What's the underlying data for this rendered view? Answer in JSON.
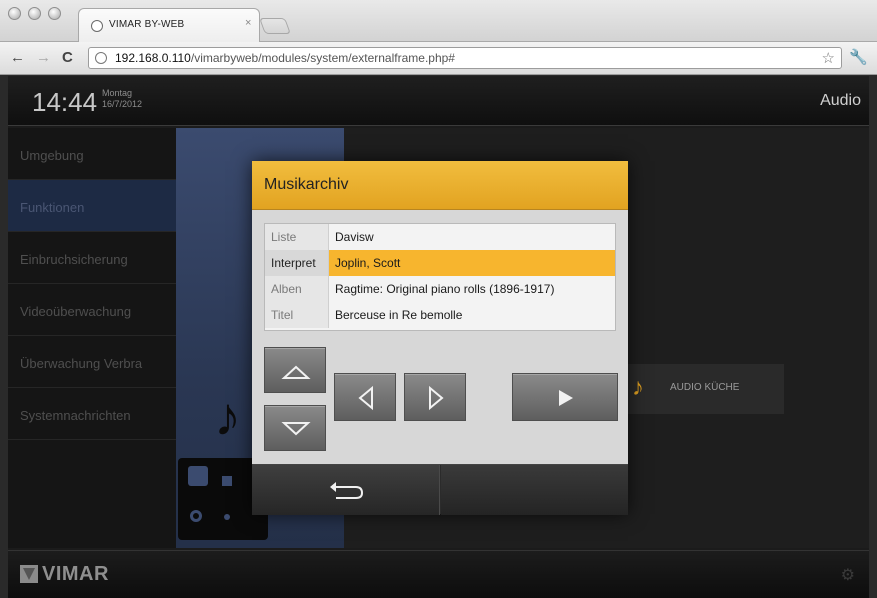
{
  "browser": {
    "tab_title": "VIMAR BY-WEB",
    "tab_close": "×",
    "url_host": "192.168.0.110",
    "url_path": "/vimarbyweb/modules/system/externalframe.php#"
  },
  "header": {
    "time": "14:44",
    "day": "Montag",
    "date": "16/7/2012",
    "section": "Audio"
  },
  "sidebar": {
    "items": [
      {
        "label": "Umgebung"
      },
      {
        "label": "Funktionen"
      },
      {
        "label": "Einbruchsicherung"
      },
      {
        "label": "Videoüberwachung"
      },
      {
        "label": "Überwachung Verbra"
      },
      {
        "label": "Systemnachrichten"
      }
    ]
  },
  "content": {
    "audio_tile_label": "AUDIO KÜCHE"
  },
  "footer": {
    "logo": "VIMAR"
  },
  "modal": {
    "title": "Musikarchiv",
    "rows": [
      {
        "key": "Liste",
        "value": "Davisw"
      },
      {
        "key": "Interpret",
        "value": "Joplin, Scott"
      },
      {
        "key": "Alben",
        "value": "Ragtime: Original piano rolls (1896-1917)"
      },
      {
        "key": "Titel",
        "value": "Berceuse in Re bemolle"
      }
    ]
  },
  "icons": {
    "up": "triangle-up-icon",
    "down": "triangle-down-icon",
    "prev": "chevron-left-icon",
    "next": "chevron-right-icon",
    "play": "play-icon",
    "back": "return-icon"
  }
}
